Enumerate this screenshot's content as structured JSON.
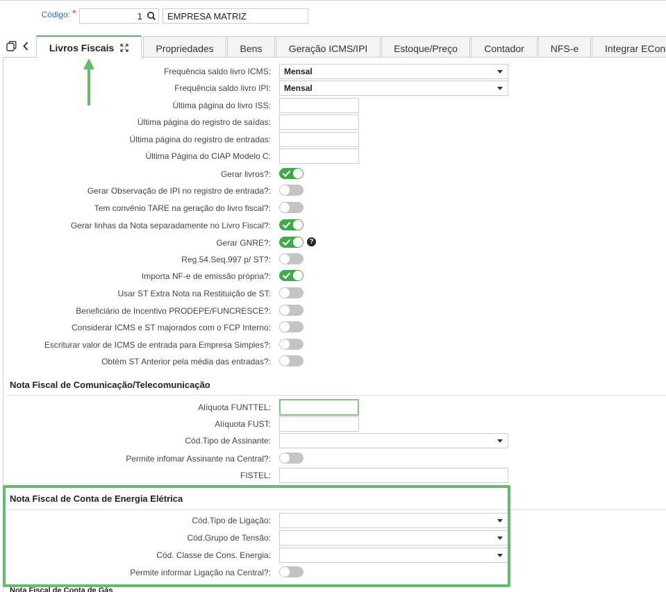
{
  "header": {
    "code_label": "Código:",
    "required_mark": "*",
    "code_value": "1",
    "company_name": "EMPRESA MATRIZ"
  },
  "tabs": [
    {
      "label": "Livros Fiscais",
      "active": true
    },
    {
      "label": "Propriedades"
    },
    {
      "label": "Bens"
    },
    {
      "label": "Geração ICMS/IPI"
    },
    {
      "label": "Estoque/Preço"
    },
    {
      "label": "Contador"
    },
    {
      "label": "NFS-e"
    },
    {
      "label": "Integrar EConect"
    }
  ],
  "fields": [
    {
      "label": "Frequência saldo livro ICMS:",
      "type": "select",
      "value": "Mensal"
    },
    {
      "label": "Frequência saldo livro IPI:",
      "type": "select",
      "value": "Mensal"
    },
    {
      "label": "Última página do livro ISS:",
      "type": "text",
      "value": ""
    },
    {
      "label": "Última página do registro de saídas:",
      "type": "text",
      "value": ""
    },
    {
      "label": "Última página do registro de entradas:",
      "type": "text",
      "value": ""
    },
    {
      "label": "Última Página do CIAP Modelo C:",
      "type": "text",
      "value": ""
    },
    {
      "label": "Gerar livros?:",
      "type": "toggle",
      "on": true
    },
    {
      "label": "Gerar Observação de IPI no registro de entrada?:",
      "type": "toggle",
      "on": false
    },
    {
      "label": "Tem convênio TARE na geração do livro fiscal?:",
      "type": "toggle",
      "on": false
    },
    {
      "label": "Gerar linhas da Nota separadamente no Livro Fiscal?:",
      "type": "toggle",
      "on": true
    },
    {
      "label": "Gerar GNRE?:",
      "type": "toggle",
      "on": true,
      "help": "?"
    },
    {
      "label": "Reg.54.Seq.997 p/ ST?:",
      "type": "toggle",
      "on": false
    },
    {
      "label": "Importa NF-e de emissão própria?:",
      "type": "toggle",
      "on": true
    },
    {
      "label": "Usar ST Extra Nota na Restituição de ST:",
      "type": "toggle",
      "on": false
    },
    {
      "label": "Beneficiário de Incentivo PRODEPE/FUNCRESCE?:",
      "type": "toggle",
      "on": false
    },
    {
      "label": "Considerar ICMS e ST majorados com o FCP Interno:",
      "type": "toggle",
      "on": false
    },
    {
      "label": "Escriturar valor de ICMS de entrada para Empresa Simples?:",
      "type": "toggle",
      "on": false
    },
    {
      "label": "Obtém ST Anterior pela média das entradas?:",
      "type": "toggle",
      "on": false
    }
  ],
  "section_telecom": {
    "title": "Nota Fiscal de Comunicação/Telecomunicação",
    "fields": [
      {
        "label": "Alíquota FUNTTEL:",
        "type": "text",
        "value": ""
      },
      {
        "label": "Alíquota FUST:",
        "type": "text",
        "value": ""
      },
      {
        "label": "Cód.Tipo de Assinante:",
        "type": "select",
        "value": ""
      },
      {
        "label": "Permite infomar Assinante na Central?:",
        "type": "toggle",
        "on": false
      },
      {
        "label": "FISTEL:",
        "type": "text",
        "value": ""
      }
    ]
  },
  "section_energia": {
    "title": "Nota Fiscal de Conta de Energia Elétrica",
    "fields": [
      {
        "label": "Cód.Tipo de Ligação:",
        "type": "select",
        "value": ""
      },
      {
        "label": "Cód.Grupo de Tensão:",
        "type": "select",
        "value": ""
      },
      {
        "label": "Cód. Classe de Cons. Energia:",
        "type": "select",
        "value": ""
      },
      {
        "label": "Permite informar Ligação na Central?:",
        "type": "toggle",
        "on": false
      }
    ]
  },
  "next_section_partial": "Nota Fiscal de Conta de Gás",
  "colors": {
    "accent_green": "#3dab4a",
    "highlight_green": "#66bb6a",
    "link_blue": "#2a6fbd",
    "required_red": "#e53935"
  }
}
